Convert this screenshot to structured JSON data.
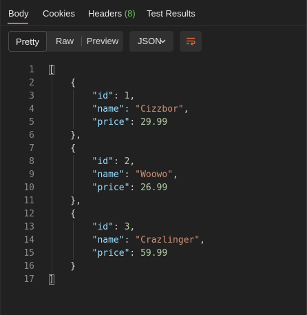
{
  "tabs": [
    {
      "label": "Body",
      "count": ""
    },
    {
      "label": "Cookies",
      "count": ""
    },
    {
      "label": "Headers",
      "count": "(8)"
    },
    {
      "label": "Test Results",
      "count": ""
    }
  ],
  "view_modes": [
    "Pretty",
    "Raw",
    "Preview"
  ],
  "active_view_mode": "Pretty",
  "format": {
    "label": "JSON"
  },
  "icons": {
    "format_dropdown": "chevron-down-icon",
    "wrap": "wrap-lines-icon"
  },
  "colors": {
    "accent": "#f26b3a",
    "key": "#9cdcfe",
    "string": "#ce9178",
    "number": "#b5cea8",
    "headers_count": "#6bbf59"
  },
  "response_body": [
    {
      "id": 1,
      "name": "Cizzbor",
      "price": "29.99"
    },
    {
      "id": 2,
      "name": "Woowo",
      "price": "26.99"
    },
    {
      "id": 3,
      "name": "Crazlinger",
      "price": "59.99"
    }
  ]
}
